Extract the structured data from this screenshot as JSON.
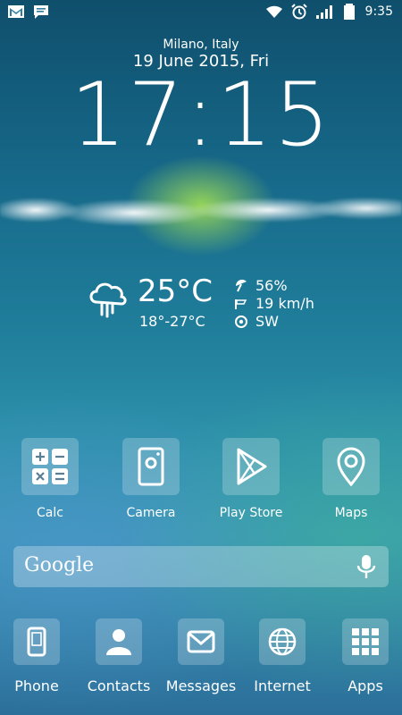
{
  "status_bar": {
    "left_icons": [
      "gmail-icon",
      "message-icon"
    ],
    "right_icons": [
      "wifi-icon",
      "alarm-icon",
      "signal-icon",
      "battery-icon"
    ],
    "time": "9:35"
  },
  "clock_widget": {
    "location": "Milano, Italy",
    "date": "19 June 2015, Fri",
    "time": "17:15"
  },
  "weather": {
    "condition_icon": "rain-cloud-icon",
    "temperature": "25°C",
    "range": "18°-27°C",
    "humidity": "56%",
    "wind_speed": "19 km/h",
    "wind_direction": "SW"
  },
  "apps": [
    {
      "label": "Calc",
      "icon": "calculator-icon"
    },
    {
      "label": "Camera",
      "icon": "camera-icon"
    },
    {
      "label": "Play Store",
      "icon": "play-store-icon"
    },
    {
      "label": "Maps",
      "icon": "map-pin-icon"
    }
  ],
  "search": {
    "logo_text": "Google",
    "mic_icon": "microphone-icon"
  },
  "dock": [
    {
      "label": "Phone",
      "icon": "phone-icon"
    },
    {
      "label": "Contacts",
      "icon": "contacts-icon"
    },
    {
      "label": "Messages",
      "icon": "mail-icon"
    },
    {
      "label": "Internet",
      "icon": "globe-icon"
    },
    {
      "label": "Apps",
      "icon": "apps-grid-icon"
    }
  ]
}
